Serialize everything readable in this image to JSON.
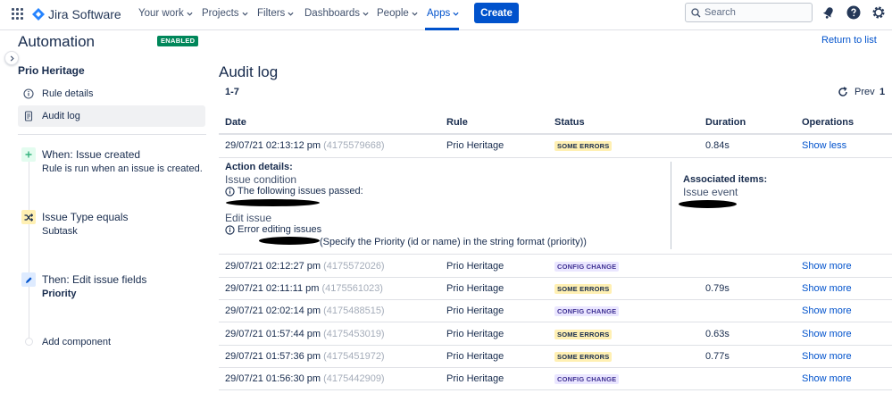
{
  "nav": {
    "brand": "Jira Software",
    "items": [
      {
        "label": "Your work"
      },
      {
        "label": "Projects"
      },
      {
        "label": "Filters"
      },
      {
        "label": "Dashboards"
      },
      {
        "label": "People"
      },
      {
        "label": "Apps"
      }
    ],
    "active_item": "Apps",
    "create_label": "Create",
    "search_placeholder": "Search"
  },
  "sidebar": {
    "title": "Automation",
    "status_badge": "ENABLED",
    "rule_name": "Prio Heritage",
    "links": [
      {
        "label": "Rule details",
        "icon": "info-icon"
      },
      {
        "label": "Audit log",
        "icon": "document-icon",
        "active": true
      }
    ],
    "components": [
      {
        "title": "When: Issue created",
        "subtitle": "Rule is run when an issue is created.",
        "icon": "plus-icon",
        "color": "#36b37e"
      },
      {
        "title": "Issue Type equals",
        "subtitle": "Subtask",
        "icon": "shuffle-icon",
        "color": "#ffab00"
      },
      {
        "title": "Then: Edit issue fields",
        "subtitle": "Priority",
        "icon": "pencil-icon",
        "color": "#0065ff"
      }
    ],
    "add_component": "Add component"
  },
  "main": {
    "return_link": "Return to list",
    "heading": "Audit log",
    "range": "1-7",
    "prev_label": "Prev",
    "page": "1",
    "columns": {
      "date": "Date",
      "rule": "Rule",
      "status": "Status",
      "duration": "Duration",
      "operations": "Operations"
    },
    "rows": [
      {
        "date": "29/07/21 02:13:12 pm",
        "id": "(4175579668)",
        "rule": "Prio Heritage",
        "status": "SOME ERRORS",
        "status_type": "errors",
        "duration": "0.84s",
        "op": "Show less"
      },
      {
        "date": "29/07/21 02:12:27 pm",
        "id": "(4175572026)",
        "rule": "Prio Heritage",
        "status": "CONFIG CHANGE",
        "status_type": "config",
        "duration": "",
        "op": "Show more"
      },
      {
        "date": "29/07/21 02:11:11 pm",
        "id": "(4175561023)",
        "rule": "Prio Heritage",
        "status": "SOME ERRORS",
        "status_type": "errors",
        "duration": "0.79s",
        "op": "Show more"
      },
      {
        "date": "29/07/21 02:02:14 pm",
        "id": "(4175488515)",
        "rule": "Prio Heritage",
        "status": "CONFIG CHANGE",
        "status_type": "config",
        "duration": "",
        "op": "Show more"
      },
      {
        "date": "29/07/21 01:57:44 pm",
        "id": "(4175453019)",
        "rule": "Prio Heritage",
        "status": "SOME ERRORS",
        "status_type": "errors",
        "duration": "0.63s",
        "op": "Show more"
      },
      {
        "date": "29/07/21 01:57:36 pm",
        "id": "(4175451972)",
        "rule": "Prio Heritage",
        "status": "SOME ERRORS",
        "status_type": "errors",
        "duration": "0.77s",
        "op": "Show more"
      },
      {
        "date": "29/07/21 01:56:30 pm",
        "id": "(4175442909)",
        "rule": "Prio Heritage",
        "status": "CONFIG CHANGE",
        "status_type": "config",
        "duration": "",
        "op": "Show more"
      }
    ],
    "details": {
      "heading": "Action details:",
      "condition_title": "Issue condition",
      "condition_msg": "The following issues passed:",
      "edit_title": "Edit issue",
      "edit_msg": "Error editing issues",
      "edit_error": "(Specify the Priority (id or name) in the string format (priority))",
      "assoc_heading": "Associated items:",
      "assoc_link": "Issue event"
    }
  }
}
